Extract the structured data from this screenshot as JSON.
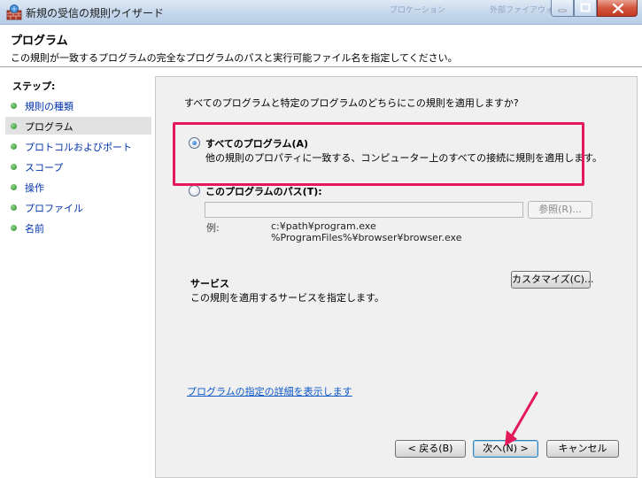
{
  "window": {
    "title": "新規の受信の規則ウイザード",
    "background_ghost": [
      "ブロケーション",
      "外部ファイアウォール"
    ]
  },
  "header": {
    "title": "プログラム",
    "description": "この規則が一致するプログラムの完全なプログラムのパスと実行可能ファイル名を指定してください。"
  },
  "steps": {
    "heading": "ステップ:",
    "items": [
      {
        "label": "規則の種類"
      },
      {
        "label": "プログラム"
      },
      {
        "label": "プロトコルおよびポート"
      },
      {
        "label": "スコープ"
      },
      {
        "label": "操作"
      },
      {
        "label": "プロファイル"
      },
      {
        "label": "名前"
      }
    ],
    "current_index": 1
  },
  "main": {
    "question": "すべてのプログラムと特定のプログラムのどちらにこの規則を適用しますか?",
    "options": [
      {
        "label": "すべてのプログラム(A)",
        "description": "他の規則のプロパティに一致する、コンピューター上のすべての接続に規則を適用します。",
        "checked": true
      },
      {
        "label": "このプログラムのパス(T):",
        "checked": false
      }
    ],
    "path_input": {
      "value": "",
      "placeholder": ""
    },
    "browse_button": "参照(R)...",
    "example_label": "例:",
    "examples": [
      "c:¥path¥program.exe",
      "%ProgramFiles%¥browser¥browser.exe"
    ],
    "services": {
      "title": "サービス",
      "description": "この規則を適用するサービスを指定します。",
      "customize_button": "カスタマイズ(C)..."
    },
    "detail_link": "プログラムの指定の詳細を表示します"
  },
  "footer": {
    "back_button": "< 戻る(B)",
    "next_button": "次へ(N) >",
    "cancel_button": "キャンセル"
  },
  "colors": {
    "highlight": "#e3195a",
    "link": "#0b57c8",
    "panel_bg": "#f0f0f0"
  },
  "icons": [
    "firewall-wizard-icon",
    "minimize-icon",
    "maximize-icon",
    "close-icon",
    "step-bullet-icon",
    "pointer-arrow-icon"
  ]
}
